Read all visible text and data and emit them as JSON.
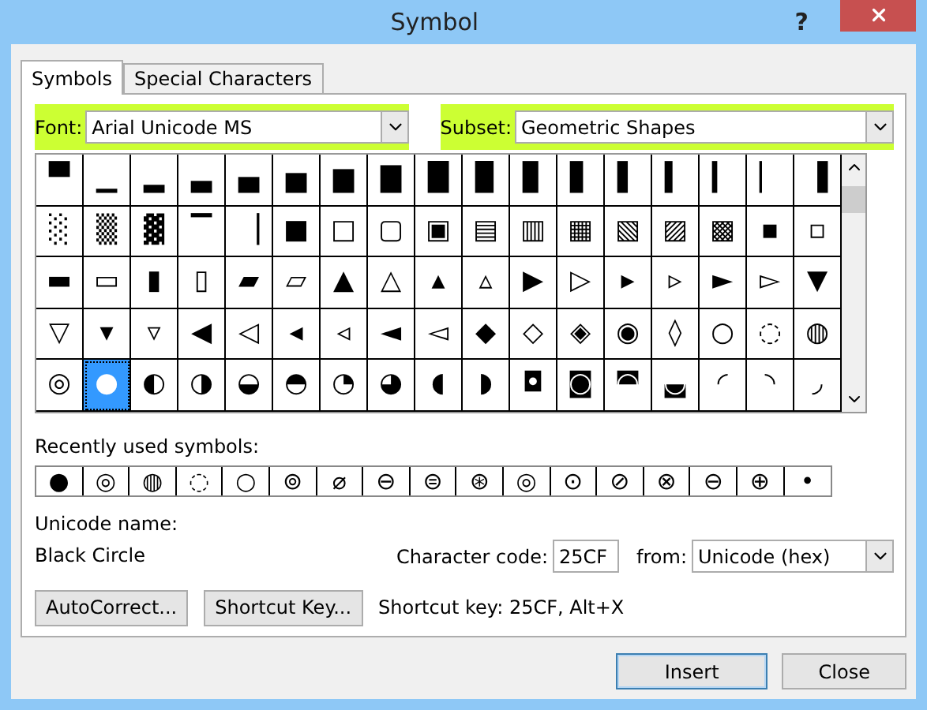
{
  "window": {
    "title": "Symbol",
    "help_button": "?"
  },
  "tabs": [
    {
      "label": "Symbols",
      "selected": true
    },
    {
      "label": "Special Characters",
      "selected": false
    }
  ],
  "font": {
    "label": "Font:",
    "value": "Arial Unicode MS",
    "highlighted": true
  },
  "subset": {
    "label": "Subset:",
    "value": "Geometric Shapes",
    "highlighted": true
  },
  "symbol_grid": [
    {
      "cells": [
        {
          "char": "▀",
          "selected": false
        },
        {
          "char": "▁",
          "selected": false
        },
        {
          "char": "▂",
          "selected": false
        },
        {
          "char": "▃",
          "selected": false
        },
        {
          "char": "▄",
          "selected": false
        },
        {
          "char": "▅",
          "selected": false
        },
        {
          "char": "▆",
          "selected": false
        },
        {
          "char": "▇",
          "selected": false
        },
        {
          "char": "█",
          "selected": false
        },
        {
          "char": "▉",
          "selected": false
        },
        {
          "char": "▊",
          "selected": false
        },
        {
          "char": "▋",
          "selected": false
        },
        {
          "char": "▌",
          "selected": false
        },
        {
          "char": "▍",
          "selected": false
        },
        {
          "char": "▎",
          "selected": false
        },
        {
          "char": "▏",
          "selected": false
        },
        {
          "char": "▐",
          "selected": false
        }
      ]
    },
    {
      "cells": [
        {
          "char": "░",
          "selected": false
        },
        {
          "char": "▒",
          "selected": false
        },
        {
          "char": "▓",
          "selected": false
        },
        {
          "char": "▔",
          "selected": false
        },
        {
          "char": "▕",
          "selected": false
        },
        {
          "char": "■",
          "selected": false
        },
        {
          "char": "□",
          "selected": false
        },
        {
          "char": "▢",
          "selected": false
        },
        {
          "char": "▣",
          "selected": false
        },
        {
          "char": "▤",
          "selected": false
        },
        {
          "char": "▥",
          "selected": false
        },
        {
          "char": "▦",
          "selected": false
        },
        {
          "char": "▧",
          "selected": false
        },
        {
          "char": "▨",
          "selected": false
        },
        {
          "char": "▩",
          "selected": false
        },
        {
          "char": "▪",
          "selected": false
        },
        {
          "char": "▫",
          "selected": false
        }
      ]
    },
    {
      "cells": [
        {
          "char": "▬",
          "selected": false
        },
        {
          "char": "▭",
          "selected": false
        },
        {
          "char": "▮",
          "selected": false
        },
        {
          "char": "▯",
          "selected": false
        },
        {
          "char": "▰",
          "selected": false
        },
        {
          "char": "▱",
          "selected": false
        },
        {
          "char": "▲",
          "selected": false
        },
        {
          "char": "△",
          "selected": false
        },
        {
          "char": "▴",
          "selected": false
        },
        {
          "char": "▵",
          "selected": false
        },
        {
          "char": "▶",
          "selected": false
        },
        {
          "char": "▷",
          "selected": false
        },
        {
          "char": "▸",
          "selected": false
        },
        {
          "char": "▹",
          "selected": false
        },
        {
          "char": "►",
          "selected": false
        },
        {
          "char": "▻",
          "selected": false
        },
        {
          "char": "▼",
          "selected": false
        }
      ]
    },
    {
      "cells": [
        {
          "char": "▽",
          "selected": false
        },
        {
          "char": "▾",
          "selected": false
        },
        {
          "char": "▿",
          "selected": false
        },
        {
          "char": "◀",
          "selected": false
        },
        {
          "char": "◁",
          "selected": false
        },
        {
          "char": "◂",
          "selected": false
        },
        {
          "char": "◃",
          "selected": false
        },
        {
          "char": "◄",
          "selected": false
        },
        {
          "char": "◅",
          "selected": false
        },
        {
          "char": "◆",
          "selected": false
        },
        {
          "char": "◇",
          "selected": false
        },
        {
          "char": "◈",
          "selected": false
        },
        {
          "char": "◉",
          "selected": false
        },
        {
          "char": "◊",
          "selected": false
        },
        {
          "char": "○",
          "selected": false
        },
        {
          "char": "◌",
          "selected": false
        },
        {
          "char": "◍",
          "selected": false
        }
      ]
    },
    {
      "cells": [
        {
          "char": "◎",
          "selected": false
        },
        {
          "char": "●",
          "selected": true
        },
        {
          "char": "◐",
          "selected": false
        },
        {
          "char": "◑",
          "selected": false
        },
        {
          "char": "◒",
          "selected": false
        },
        {
          "char": "◓",
          "selected": false
        },
        {
          "char": "◔",
          "selected": false
        },
        {
          "char": "◕",
          "selected": false
        },
        {
          "char": "◖",
          "selected": false
        },
        {
          "char": "◗",
          "selected": false
        },
        {
          "char": "◘",
          "selected": false
        },
        {
          "char": "◙",
          "selected": false
        },
        {
          "char": "◚",
          "selected": false
        },
        {
          "char": "◛",
          "selected": false
        },
        {
          "char": "◜",
          "selected": false
        },
        {
          "char": "◝",
          "selected": false
        },
        {
          "char": "◞",
          "selected": false
        }
      ]
    }
  ],
  "recently_used": {
    "label": "Recently used symbols:",
    "symbols": [
      "●",
      "◎",
      "◍",
      "◌",
      "○",
      "⊚",
      "⌀",
      "⊖",
      "⊜",
      "⊛",
      "◎",
      "⊙",
      "⊘",
      "⊗",
      "⊖",
      "⊕",
      "•"
    ]
  },
  "unicode_name": {
    "label": "Unicode name:",
    "value": "Black Circle"
  },
  "character_code": {
    "label": "Character code:",
    "value": "25CF"
  },
  "from": {
    "label": "from:",
    "value": "Unicode (hex)"
  },
  "buttons": [
    "AutoCorrect...",
    "Shortcut Key..."
  ],
  "shortcut_key": "Shortcut key: 25CF, Alt+X",
  "footer_buttons": [
    {
      "label": "Insert",
      "default": true
    },
    {
      "label": "Close",
      "default": false
    }
  ]
}
